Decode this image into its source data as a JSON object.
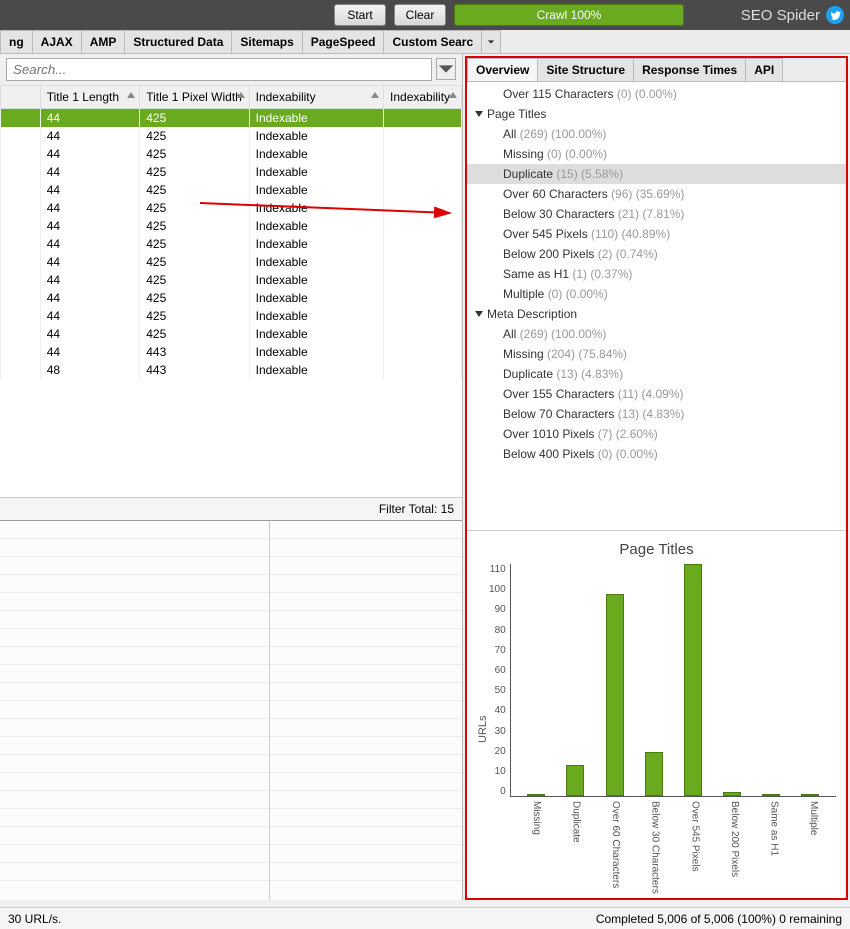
{
  "topbar": {
    "start": "Start",
    "clear": "Clear",
    "crawl": "Crawl 100%"
  },
  "brand": "SEO Spider",
  "tabs_left": [
    "ng",
    "AJAX",
    "AMP",
    "Structured Data",
    "Sitemaps",
    "PageSpeed",
    "Custom Searc"
  ],
  "search_placeholder": "Search...",
  "columns": [
    "",
    "Title 1 Length",
    "Title 1 Pixel Width",
    "Indexability",
    "Indexability "
  ],
  "rows": [
    {
      "len": "44",
      "px": "425",
      "idx": "Indexable",
      "sel": true
    },
    {
      "len": "44",
      "px": "425",
      "idx": "Indexable"
    },
    {
      "len": "44",
      "px": "425",
      "idx": "Indexable"
    },
    {
      "len": "44",
      "px": "425",
      "idx": "Indexable"
    },
    {
      "len": "44",
      "px": "425",
      "idx": "Indexable"
    },
    {
      "len": "44",
      "px": "425",
      "idx": "Indexable"
    },
    {
      "len": "44",
      "px": "425",
      "idx": "Indexable"
    },
    {
      "len": "44",
      "px": "425",
      "idx": "Indexable"
    },
    {
      "len": "44",
      "px": "425",
      "idx": "Indexable"
    },
    {
      "len": "44",
      "px": "425",
      "idx": "Indexable"
    },
    {
      "len": "44",
      "px": "425",
      "idx": "Indexable"
    },
    {
      "len": "44",
      "px": "425",
      "idx": "Indexable"
    },
    {
      "len": "44",
      "px": "425",
      "idx": "Indexable"
    },
    {
      "len": "44",
      "px": "443",
      "idx": "Indexable"
    },
    {
      "len": "48",
      "px": "443",
      "idx": "Indexable"
    }
  ],
  "filter_total": "Filter Total:   15",
  "rtabs": [
    "Overview",
    "Site Structure",
    "Response Times",
    "API"
  ],
  "tree": [
    {
      "t": "sub",
      "label": "Over 115 Characters",
      "count": "(0) (0.00%)"
    },
    {
      "t": "group",
      "label": "Page Titles"
    },
    {
      "t": "sub",
      "label": "All",
      "count": "(269) (100.00%)"
    },
    {
      "t": "sub",
      "label": "Missing",
      "count": "(0) (0.00%)"
    },
    {
      "t": "sub",
      "label": "Duplicate",
      "count": "(15) (5.58%)",
      "hl": true
    },
    {
      "t": "sub",
      "label": "Over 60 Characters",
      "count": "(96) (35.69%)"
    },
    {
      "t": "sub",
      "label": "Below 30 Characters",
      "count": "(21) (7.81%)"
    },
    {
      "t": "sub",
      "label": "Over 545 Pixels",
      "count": "(110) (40.89%)"
    },
    {
      "t": "sub",
      "label": "Below 200 Pixels",
      "count": "(2) (0.74%)"
    },
    {
      "t": "sub",
      "label": "Same as H1",
      "count": "(1) (0.37%)"
    },
    {
      "t": "sub",
      "label": "Multiple",
      "count": "(0) (0.00%)"
    },
    {
      "t": "group",
      "label": "Meta Description"
    },
    {
      "t": "sub",
      "label": "All",
      "count": "(269) (100.00%)"
    },
    {
      "t": "sub",
      "label": "Missing",
      "count": "(204) (75.84%)"
    },
    {
      "t": "sub",
      "label": "Duplicate",
      "count": "(13) (4.83%)"
    },
    {
      "t": "sub",
      "label": "Over 155 Characters",
      "count": "(11) (4.09%)"
    },
    {
      "t": "sub",
      "label": "Below 70 Characters",
      "count": "(13) (4.83%)"
    },
    {
      "t": "sub",
      "label": "Over 1010 Pixels",
      "count": "(7) (2.60%)"
    },
    {
      "t": "sub",
      "label": "Below 400 Pixels",
      "count": "(0) (0.00%)"
    }
  ],
  "chart_data": {
    "type": "bar",
    "title": "Page Titles",
    "ylabel": "URLs",
    "ylim": [
      0,
      110
    ],
    "categories": [
      "Missing",
      "Duplicate",
      "Over 60 Characters",
      "Below 30 Characters",
      "Over 545 Pixels",
      "Below 200 Pixels",
      "Same as H1",
      "Multiple"
    ],
    "values": [
      0,
      15,
      96,
      21,
      110,
      2,
      1,
      0
    ]
  },
  "status_left": "30 URL/s.",
  "status_right": "Completed 5,006 of 5,006 (100%) 0 remaining"
}
